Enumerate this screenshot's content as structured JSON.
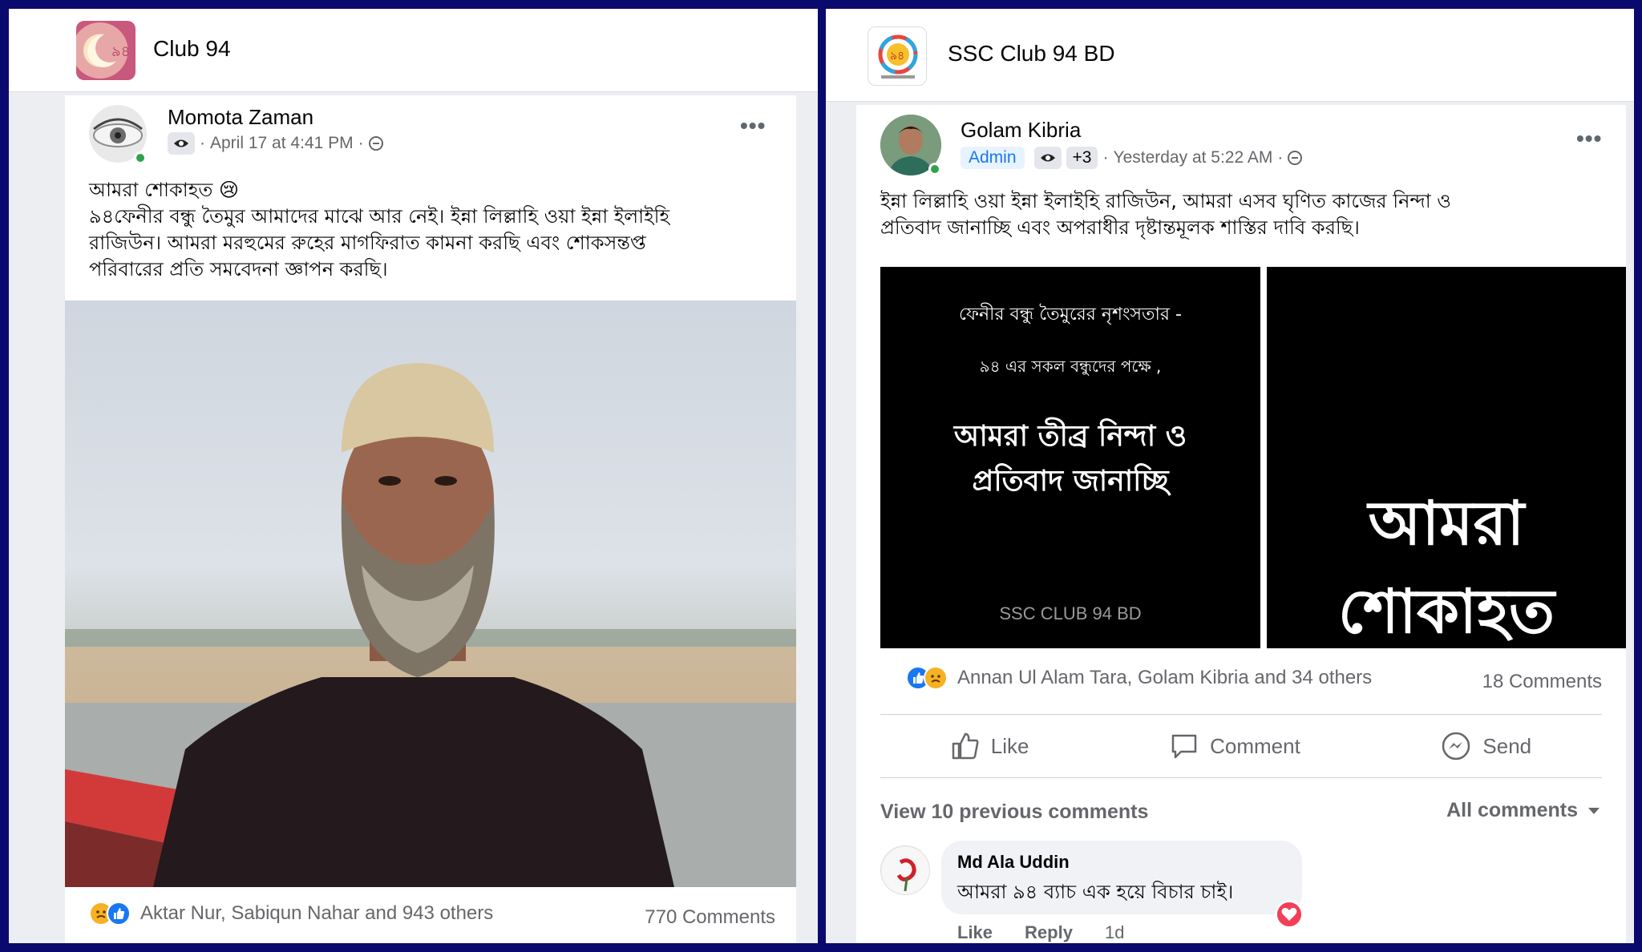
{
  "left": {
    "group": {
      "name": "Club 94"
    },
    "post": {
      "author": "Momota Zaman",
      "timestamp": "April 17 at 4:41 PM",
      "text_lines": [
        "আমরা শোকাহত 😢",
        "৯৪ফেনীর বন্ধু  তৈমুর আমাদের মাঝে আর নেই। ইন্না লিল্লাহি ওয়া ইন্না ইলাইহি",
        "রাজিউন। আমরা মরহুমের রুহের মাগফিরাত কামনা করছি এবং শোকসন্তপ্ত",
        "পরিবারের প্রতি সমবেদনা জ্ঞাপন করছি।"
      ],
      "reactions_text": "Aktar Nur, Sabiqun Nahar and 943 others",
      "comments_count": "770 Comments"
    }
  },
  "right": {
    "group": {
      "name": "SSC Club 94 BD"
    },
    "post": {
      "author": "Golam Kibria",
      "role_badge": "Admin",
      "extra_badges": "+3",
      "timestamp": "Yesterday at 5:22 AM",
      "text_lines": [
        "ইন্না লিল্লাহি ওয়া ইন্না ইলাইহি রাজিউন,  আমরা এসব ঘৃণিত কাজের নিন্দা ও",
        "প্রতিবাদ জানাচ্ছি এবং অপরাধীর দৃষ্টান্তমূলক শাস্তির দাবি করছি।"
      ],
      "image1": {
        "line1": "ফেনীর বন্ধু তৈমুরের নৃশংসতার -",
        "line2": "৯৪ এর সকল বন্ধুদের পক্ষে ,",
        "headline1": "আমরা তীব্র নিন্দা ও",
        "headline2": "প্রতিবাদ জানাচ্ছি",
        "watermark": "SSC CLUB 94 BD"
      },
      "image2": {
        "headline1": "আমরা",
        "headline2": "শোকাহত"
      },
      "reactions_text": "Annan Ul Alam Tara, Golam Kibria and 34 others",
      "comments_count": "18 Comments",
      "actions": {
        "like": "Like",
        "comment": "Comment",
        "send": "Send"
      },
      "view_previous": "View 10 previous comments",
      "comment_filter": "All comments",
      "comment": {
        "author": "Md Ala Uddin",
        "text": "আমরা ৯৪ ব্যাচ এক হয়ে বিচার চাই।",
        "like": "Like",
        "reply": "Reply",
        "time": "1d"
      }
    }
  },
  "colors": {
    "frame": "#0a0a6e",
    "facebook_blue": "#1877f2",
    "admin_badge_bg": "#e7f3ff",
    "online": "#31a24c",
    "heart": "#f33e58"
  }
}
